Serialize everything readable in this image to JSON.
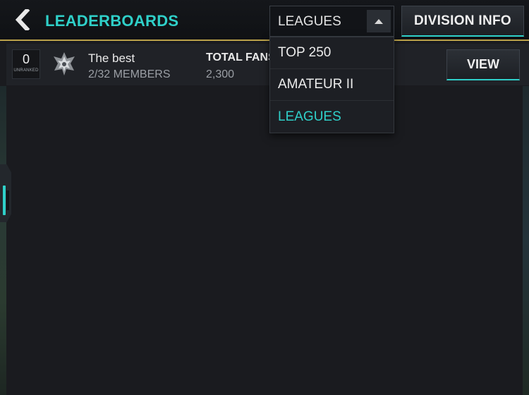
{
  "header": {
    "title": "LEADERBOARDS",
    "league_select_value": "LEAGUES",
    "division_info_label": "DIVISION INFO"
  },
  "dropdown": {
    "items": [
      {
        "label": "TOP 250",
        "selected": false
      },
      {
        "label": "AMATEUR II",
        "selected": false
      },
      {
        "label": "LEAGUES",
        "selected": true
      }
    ]
  },
  "league_row": {
    "rank": "0",
    "rank_label": "UNRANKED",
    "name": "The best",
    "members": "2/32 MEMBERS",
    "fans_label": "TOTAL FANS",
    "fans_value": "2,300",
    "view_label": "VIEW"
  },
  "colors": {
    "accent": "#2fd0c9",
    "gold_rule": "#bba24a",
    "background": "#1a1b1f"
  },
  "icons": {
    "back": "back-chevron-icon",
    "select_arrow": "caret-up-icon",
    "emblem": "league-emblem-icon"
  }
}
